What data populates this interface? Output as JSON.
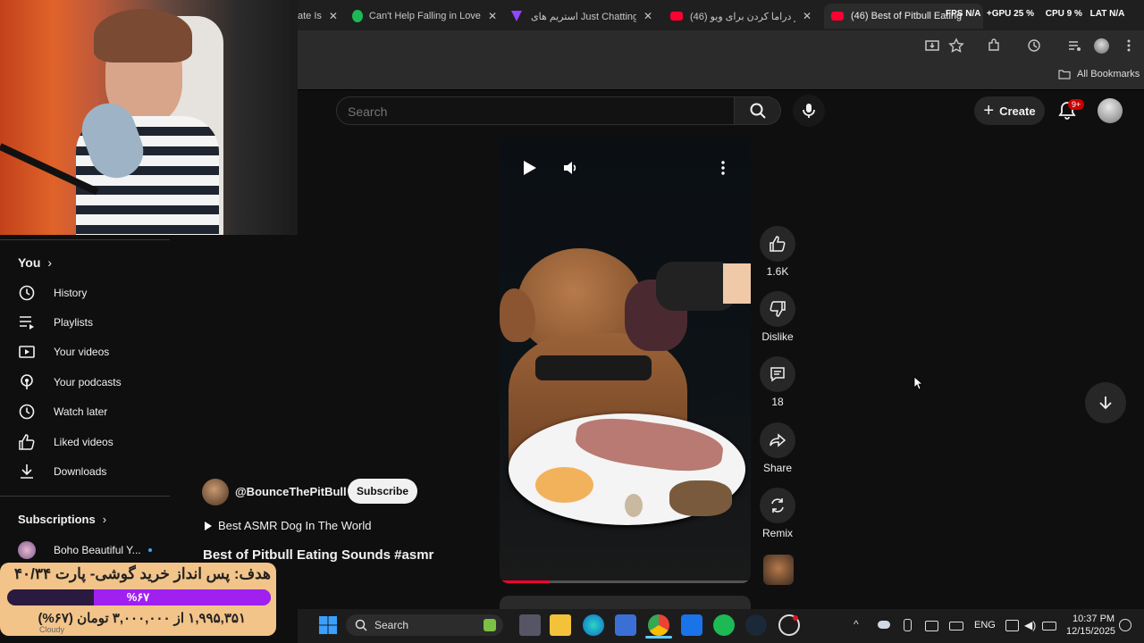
{
  "browser": {
    "tabs": [
      {
        "title": "ate Is"
      },
      {
        "title": "Can't Help Falling in Love"
      },
      {
        "title": "استریم های Just Chatting -"
      },
      {
        "title": "(46) از دراما کردن برای ویو U"
      },
      {
        "title": "(46) Best of Pitbull Eating"
      }
    ],
    "overlay_stats": {
      "fps_label": "FPS",
      "fps": "N/A",
      "gpu_label": "GPU",
      "gpu": "25 %",
      "cpu_label": "CPU",
      "cpu": "9 %",
      "lat_label": "LAT",
      "lat": "N/A"
    },
    "bookmarks_label": "All Bookmarks",
    "close_glyph": "✕"
  },
  "header": {
    "search_placeholder": "Search",
    "create_label": "Create",
    "notification_count": "9+"
  },
  "sidebar": {
    "you_label": "You",
    "items": [
      {
        "label": "History",
        "icon": "history-icon"
      },
      {
        "label": "Playlists",
        "icon": "playlist-icon"
      },
      {
        "label": "Your videos",
        "icon": "video-icon"
      },
      {
        "label": "Your podcasts",
        "icon": "podcast-icon"
      },
      {
        "label": "Watch later",
        "icon": "clock-icon"
      },
      {
        "label": "Liked videos",
        "icon": "thumbs-up-icon"
      },
      {
        "label": "Downloads",
        "icon": "download-icon"
      }
    ],
    "subscriptions_label": "Subscriptions",
    "subscription_first": "Boho Beautiful Y..."
  },
  "short": {
    "likes": "1.6K",
    "dislike_label": "Dislike",
    "comments": "18",
    "share_label": "Share",
    "remix_label": "Remix",
    "channel": "@BounceThePitBull",
    "subscribe_label": "Subscribe",
    "playlist_title": "Best ASMR Dog In The World",
    "title": "Best of Pitbull Eating Sounds #asmr",
    "progress": 0.2
  },
  "donation": {
    "goal_text": "هدف: پس انداز خرید گوشی- پارت ۴۰/۳۴",
    "percent_text": "%۶۷",
    "progress": 0.67,
    "amount_text": "۱,۹۹۵,۳۵۱ از ۳,۰۰۰,۰۰۰ تومان (۶۷%)"
  },
  "taskbar": {
    "search_label": "Search",
    "language": "ENG",
    "time": "10:37 PM",
    "date": "12/15/2025",
    "weather_label": "Cloudy"
  },
  "colors": {
    "youtube_red": "#ff0033",
    "goal_bar": "#a020f0",
    "goal_bg": "#f2c48a",
    "spotify": "#1db954"
  }
}
